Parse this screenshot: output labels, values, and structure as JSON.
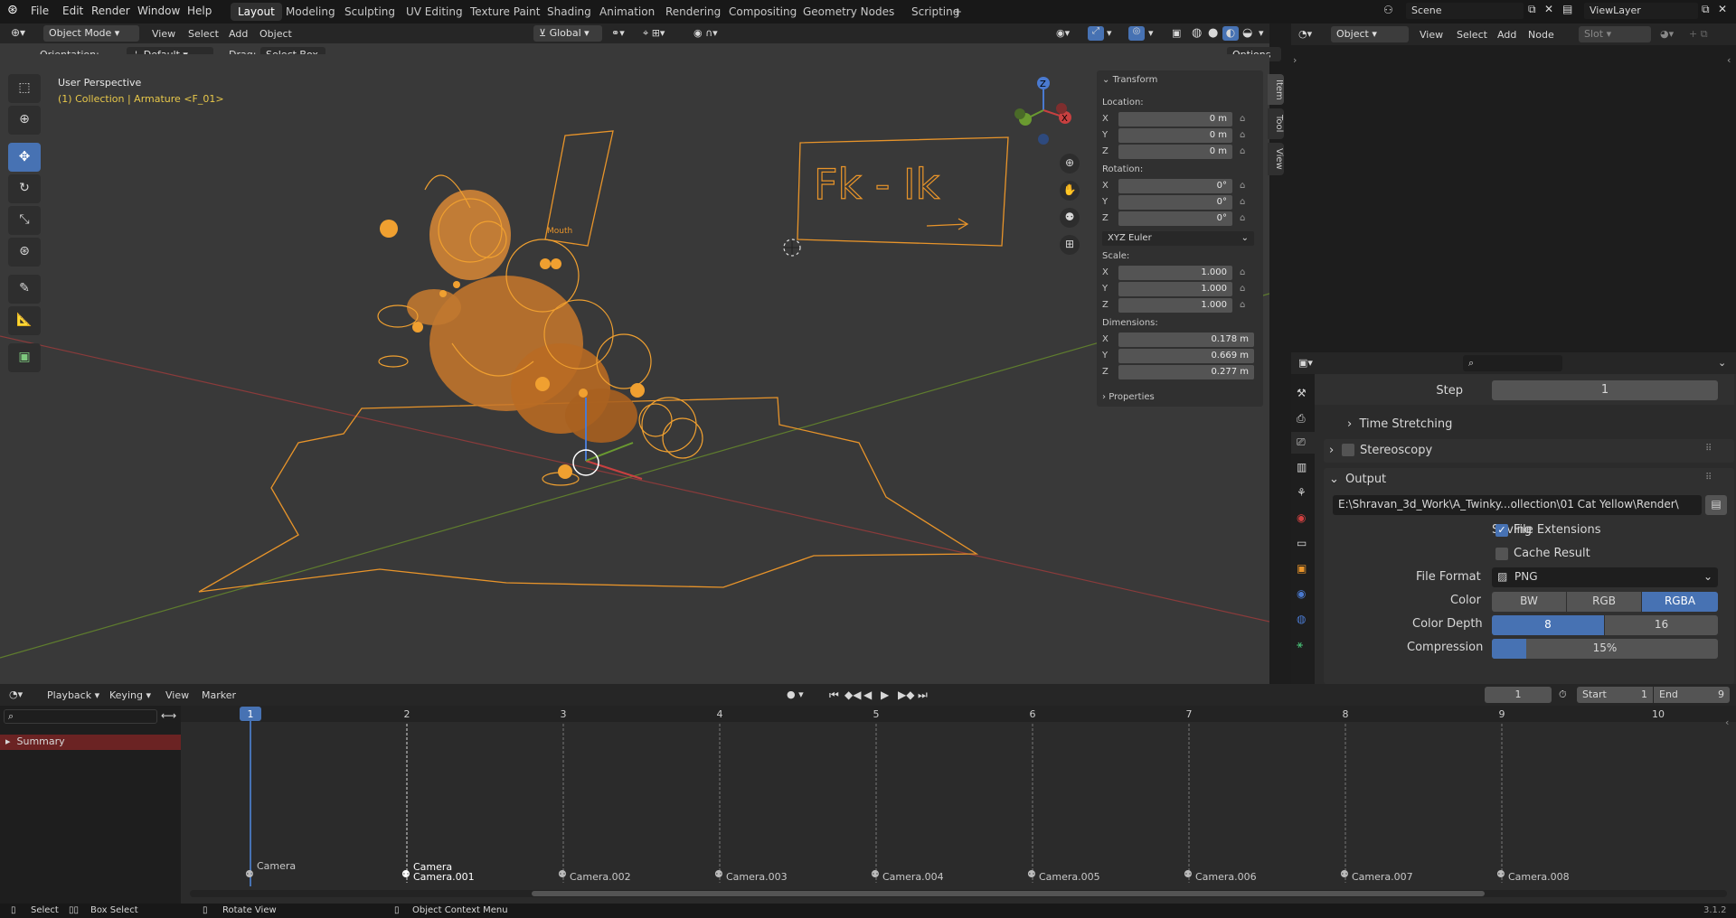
{
  "topbar": {
    "menus": [
      "File",
      "Edit",
      "Render",
      "Window",
      "Help"
    ],
    "workspaces": [
      "Layout",
      "Modeling",
      "Sculpting",
      "UV Editing",
      "Texture Paint",
      "Shading",
      "Animation",
      "Rendering",
      "Compositing",
      "Geometry Nodes",
      "Scripting"
    ],
    "active_workspace": "Layout",
    "add_tab": "+",
    "scene": "Scene",
    "view_layer": "ViewLayer"
  },
  "viewport_header": {
    "mode": "Object Mode",
    "menus": [
      "View",
      "Select",
      "Add",
      "Object"
    ],
    "transform_orientation": "Global",
    "options": "Options"
  },
  "tool_header": {
    "orientation_label": "Orientation:",
    "orientation_value": "Default",
    "drag_label": "Drag:",
    "drag_value": "Select Box"
  },
  "viewport": {
    "perspective": "User Perspective",
    "collection": "(1) Collection | Armature <F_01>",
    "sign_text": "Fk  -  Ik",
    "mouth_label": "Mouth",
    "axis_x": "X",
    "axis_y": "Y",
    "axis_z": "Z"
  },
  "npanel": {
    "tabs": [
      "Item",
      "Tool",
      "View"
    ],
    "transform_title": "Transform",
    "location_label": "Location:",
    "location": [
      {
        "axis": "X",
        "value": "0 m"
      },
      {
        "axis": "Y",
        "value": "0 m"
      },
      {
        "axis": "Z",
        "value": "0 m"
      }
    ],
    "rotation_label": "Rotation:",
    "rotation": [
      {
        "axis": "X",
        "value": "0°"
      },
      {
        "axis": "Y",
        "value": "0°"
      },
      {
        "axis": "Z",
        "value": "0°"
      }
    ],
    "rotation_mode": "XYZ Euler",
    "scale_label": "Scale:",
    "scale": [
      {
        "axis": "X",
        "value": "1.000"
      },
      {
        "axis": "Y",
        "value": "1.000"
      },
      {
        "axis": "Z",
        "value": "1.000"
      }
    ],
    "dimensions_label": "Dimensions:",
    "dimensions": [
      {
        "axis": "X",
        "value": "0.178 m"
      },
      {
        "axis": "Y",
        "value": "0.669 m"
      },
      {
        "axis": "Z",
        "value": "0.277 m"
      }
    ],
    "properties_title": "Properties"
  },
  "node_editor": {
    "type": "Object",
    "menus": [
      "View",
      "Select",
      "Add",
      "Node"
    ],
    "slot": "Slot"
  },
  "properties": {
    "step_label": "Step",
    "step_value": "1",
    "time_stretching": "Time Stretching",
    "stereoscopy": "Stereoscopy",
    "output_title": "Output",
    "output_path": "E:\\Shravan_3d_Work\\A_Twinky...ollection\\01 Cat Yellow\\Render\\",
    "saving_label": "Saving",
    "file_extensions": "File Extensions",
    "file_extensions_checked": true,
    "cache_result": "Cache Result",
    "cache_result_checked": false,
    "file_format_label": "File Format",
    "file_format": "PNG",
    "color_label": "Color",
    "color_options": [
      "BW",
      "RGB",
      "RGBA"
    ],
    "color_selected": "RGBA",
    "color_depth_label": "Color Depth",
    "color_depth_options": [
      "8",
      "16"
    ],
    "color_depth_selected": "8",
    "compression_label": "Compression",
    "compression_value": "15%",
    "compression_fraction": 0.15
  },
  "timeline": {
    "menus": [
      "Playback",
      "Keying",
      "View",
      "Marker"
    ],
    "current_frame": "1",
    "start_label": "Start",
    "start_value": "1",
    "end_label": "End",
    "end_value": "9",
    "summary": "Summary",
    "frame_numbers": [
      "1",
      "2",
      "3",
      "4",
      "5",
      "6",
      "7",
      "8",
      "9",
      "10"
    ],
    "markers": [
      "Camera",
      "Camera.001",
      "Camera.002",
      "Camera.003",
      "Camera.004",
      "Camera.005",
      "Camera.006",
      "Camera.007",
      "Camera.008"
    ],
    "marker_selected_label": "Camera"
  },
  "statusbar": {
    "select": "Select",
    "box_select": "Box Select",
    "rotate_view": "Rotate View",
    "context_menu": "Object Context Menu",
    "version": "3.1.2"
  },
  "colors": {
    "accent": "#4772b3",
    "selection_orange": "#f0a030",
    "axis_red": "#c84040",
    "axis_green": "#6a9a30"
  }
}
